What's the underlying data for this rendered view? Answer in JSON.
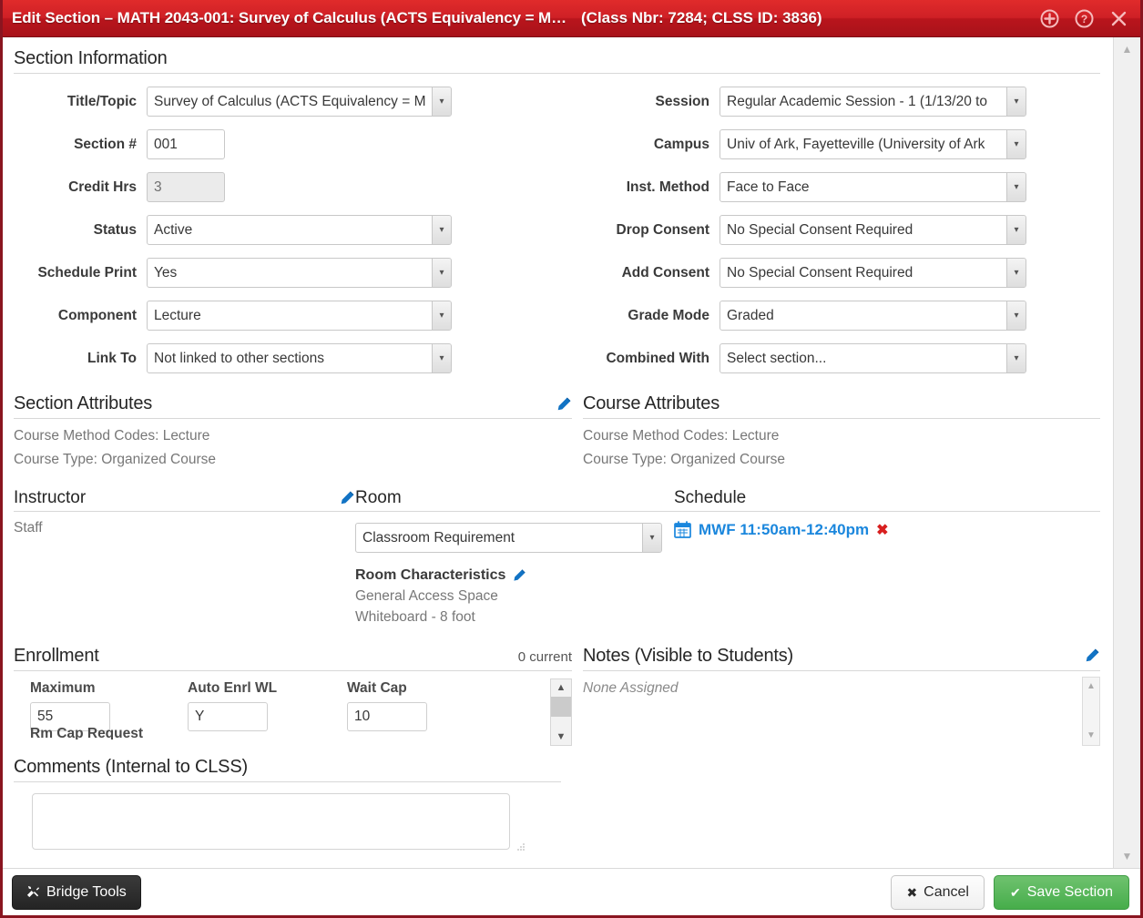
{
  "window": {
    "title": "Edit Section – MATH 2043-001: Survey of Calculus (ACTS Equivalency = M…",
    "subtitle": "(Class Nbr: 7284; CLSS ID: 3836)",
    "icons": {
      "add": "plus-circle-icon",
      "help": "question-circle-icon",
      "close": "close-icon"
    },
    "accent_color": "#c2202a",
    "link_color": "#1273c4"
  },
  "section_information": {
    "heading": "Section Information",
    "left_fields": [
      {
        "label": "Title/Topic",
        "value": "Survey of Calculus (ACTS Equivalency = M",
        "type": "select",
        "name": "title-topic"
      },
      {
        "label": "Section #",
        "value": "001",
        "type": "text",
        "name": "section-number"
      },
      {
        "label": "Credit Hrs",
        "value": "3",
        "type": "text-readonly",
        "name": "credit-hours"
      },
      {
        "label": "Status",
        "value": "Active",
        "type": "select",
        "name": "status"
      },
      {
        "label": "Schedule Print",
        "value": "Yes",
        "type": "select",
        "name": "schedule-print"
      },
      {
        "label": "Component",
        "value": "Lecture",
        "type": "select",
        "name": "component"
      },
      {
        "label": "Link To",
        "value": "Not linked to other sections",
        "type": "select",
        "name": "link-to"
      }
    ],
    "right_fields": [
      {
        "label": "Session",
        "value": "Regular Academic Session - 1 (1/13/20 to",
        "type": "select",
        "name": "session"
      },
      {
        "label": "Campus",
        "value": "Univ of Ark, Fayetteville (University of Ark",
        "type": "select",
        "name": "campus"
      },
      {
        "label": "Inst. Method",
        "value": "Face to Face",
        "type": "select",
        "name": "instruction-method"
      },
      {
        "label": "Drop Consent",
        "value": "No Special Consent Required",
        "type": "select",
        "name": "drop-consent"
      },
      {
        "label": "Add Consent",
        "value": "No Special Consent Required",
        "type": "select",
        "name": "add-consent"
      },
      {
        "label": "Grade Mode",
        "value": "Graded",
        "type": "select",
        "name": "grade-mode"
      },
      {
        "label": "Combined With",
        "value": "Select section...",
        "type": "select",
        "name": "combined-with"
      }
    ]
  },
  "section_attributes": {
    "heading": "Section Attributes",
    "lines": [
      "Course Method Codes: Lecture",
      "Course Type: Organized Course"
    ]
  },
  "course_attributes": {
    "heading": "Course Attributes",
    "lines": [
      "Course Method Codes: Lecture",
      "Course Type: Organized Course"
    ]
  },
  "instructor": {
    "heading": "Instructor",
    "value": "Staff"
  },
  "room": {
    "heading": "Room",
    "requirement": "Classroom Requirement",
    "characteristics_heading": "Room Characteristics",
    "characteristics": [
      "General Access Space",
      "Whiteboard - 8 foot"
    ]
  },
  "schedule": {
    "heading": "Schedule",
    "entries": [
      {
        "icon": "calendar-icon",
        "text": "MWF 11:50am-12:40pm",
        "remove_icon": "remove-icon"
      }
    ]
  },
  "enrollment": {
    "heading": "Enrollment",
    "current": "0 current",
    "fields": [
      {
        "label": "Maximum",
        "value": "55",
        "name": "maximum"
      },
      {
        "label": "Auto Enrl WL",
        "value": "Y",
        "name": "auto-enrl-wl"
      },
      {
        "label": "Wait Cap",
        "value": "10",
        "name": "wait-cap"
      }
    ],
    "cut_off_label": "Rm Cap Request"
  },
  "notes": {
    "heading": "Notes (Visible to Students)",
    "body": "None Assigned"
  },
  "comments": {
    "heading": "Comments (Internal to CLSS)",
    "value": "",
    "placeholder": ""
  },
  "footer": {
    "bridge_tools": "Bridge Tools",
    "bridge_tools_icon": "tools-icon",
    "cancel": "Cancel",
    "cancel_icon": "x-icon",
    "save": "Save Section",
    "save_icon": "check-icon"
  }
}
